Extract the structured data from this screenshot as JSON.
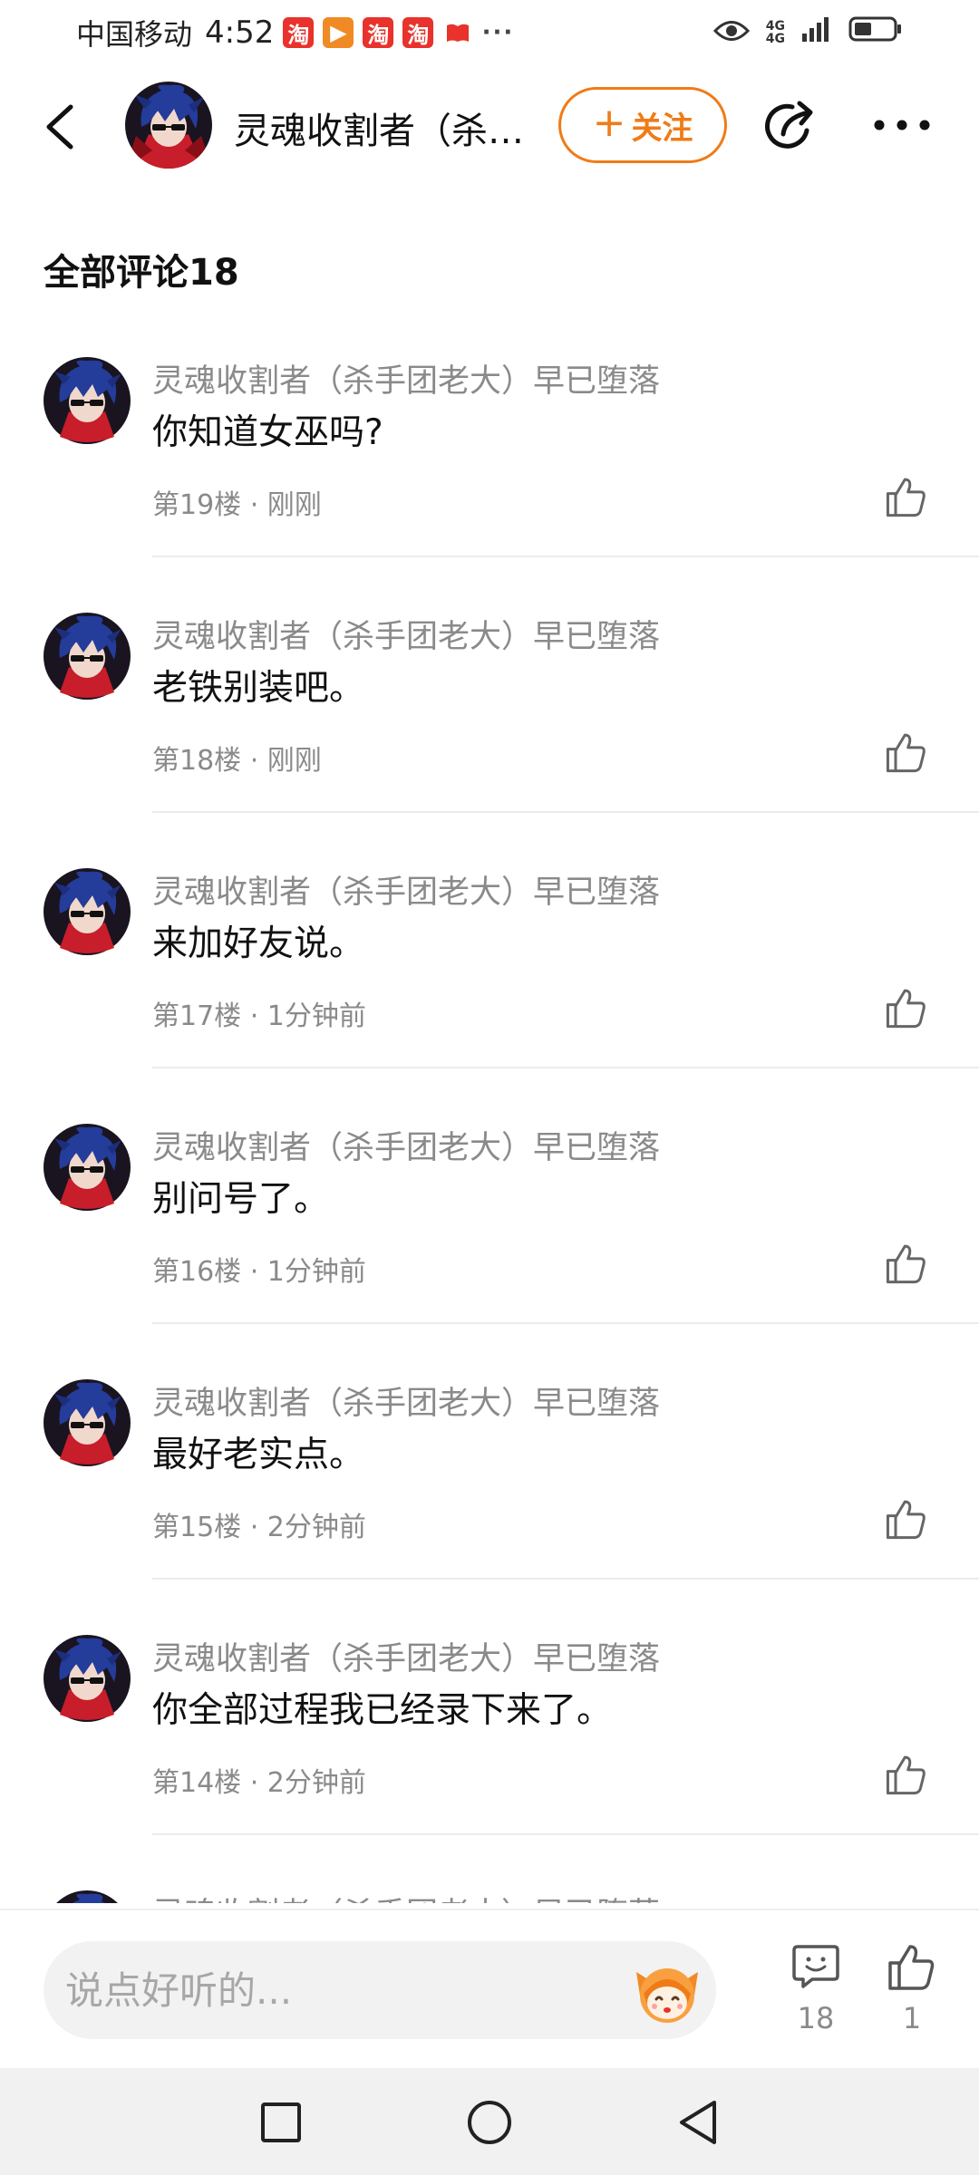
{
  "status_bar": {
    "carrier": "中国移动",
    "time": "4:52",
    "notifications": [
      "淘",
      "▶",
      "淘",
      "淘"
    ],
    "network_top": "4G",
    "network_bottom": "4G"
  },
  "header": {
    "title": "灵魂收割者（杀…",
    "follow_label": "关注"
  },
  "comments_section": {
    "title": "全部评论18"
  },
  "comments": [
    {
      "author": "灵魂收割者（杀手团老大）早已堕落",
      "text": "你知道女巫吗?",
      "meta": "第19楼 · 刚刚"
    },
    {
      "author": "灵魂收割者（杀手团老大）早已堕落",
      "text": "老铁别装吧。",
      "meta": "第18楼 · 刚刚"
    },
    {
      "author": "灵魂收割者（杀手团老大）早已堕落",
      "text": "来加好友说。",
      "meta": "第17楼 · 1分钟前"
    },
    {
      "author": "灵魂收割者（杀手团老大）早已堕落",
      "text": "别问号了。",
      "meta": "第16楼 · 1分钟前"
    },
    {
      "author": "灵魂收割者（杀手团老大）早已堕落",
      "text": "最好老实点。",
      "meta": "第15楼 · 2分钟前"
    },
    {
      "author": "灵魂收割者（杀手团老大）早已堕落",
      "text": "你全部过程我已经录下来了。",
      "meta": "第14楼 · 2分钟前"
    },
    {
      "author": "灵魂收割者（杀手团老大）早已堕落",
      "text": "",
      "meta": ""
    }
  ],
  "bottom_bar": {
    "input_placeholder": "说点好听的...",
    "comment_count": "18",
    "like_count": "1"
  },
  "colors": {
    "accent": "#f07b16",
    "meta_gray": "#8a8a8a",
    "divider": "#ececec"
  },
  "icons": {
    "back": "back-arrow-icon",
    "share": "share-icon",
    "more": "more-dots-icon",
    "like": "thumbs-up-icon",
    "comment": "comment-bubble-icon",
    "emoji": "emoji-sticker-icon"
  }
}
